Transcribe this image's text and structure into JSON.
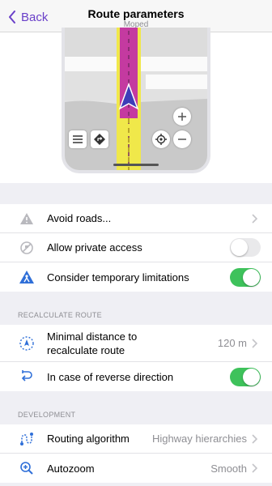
{
  "header": {
    "back_label": "Back",
    "title": "Route parameters",
    "subtitle": "Moped"
  },
  "accent": "#6a40c9",
  "route_items": [
    {
      "label": "Avoid roads...",
      "icon": "warning-icon",
      "type": "link"
    },
    {
      "label": "Allow private access",
      "icon": "no-entry-icon",
      "type": "toggle",
      "on": false
    },
    {
      "label": "Consider temporary limitations",
      "icon": "road-works-icon",
      "type": "toggle",
      "on": true
    }
  ],
  "recalculate": {
    "header": "RECALCULATE ROUTE",
    "items": [
      {
        "label": "Minimal distance to recalculate route",
        "value": "120 m",
        "icon": "navigation-target-icon",
        "type": "link"
      },
      {
        "label": "In case of reverse direction",
        "icon": "reverse-direction-icon",
        "type": "toggle",
        "on": true
      }
    ]
  },
  "development": {
    "header": "DEVELOPMENT",
    "items": [
      {
        "label": "Routing algorithm",
        "value": "Highway hierarchies",
        "icon": "routing-graph-icon",
        "type": "link"
      },
      {
        "label": "Autozoom",
        "value": "Smooth",
        "icon": "zoom-icon",
        "type": "link"
      }
    ]
  }
}
